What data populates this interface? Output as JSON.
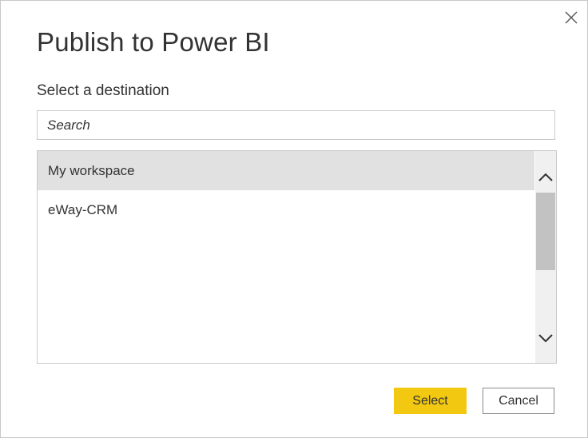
{
  "dialog": {
    "title": "Publish to Power BI",
    "subtitle": "Select a destination",
    "close_icon": "close-icon"
  },
  "search": {
    "placeholder": "Search",
    "value": ""
  },
  "destinations": {
    "items": [
      {
        "label": "My workspace",
        "selected": true
      },
      {
        "label": "eWay-CRM",
        "selected": false
      }
    ],
    "scroll_up_icon": "chevron-up-icon",
    "scroll_down_icon": "chevron-down-icon"
  },
  "buttons": {
    "select_label": "Select",
    "cancel_label": "Cancel"
  },
  "colors": {
    "accent": "#f2c811",
    "selected_row": "#e1e1e1",
    "scrollbar_track": "#f0f0f0",
    "scrollbar_thumb": "#c2c2c2",
    "text": "#333333",
    "border": "#c8c8c8"
  }
}
